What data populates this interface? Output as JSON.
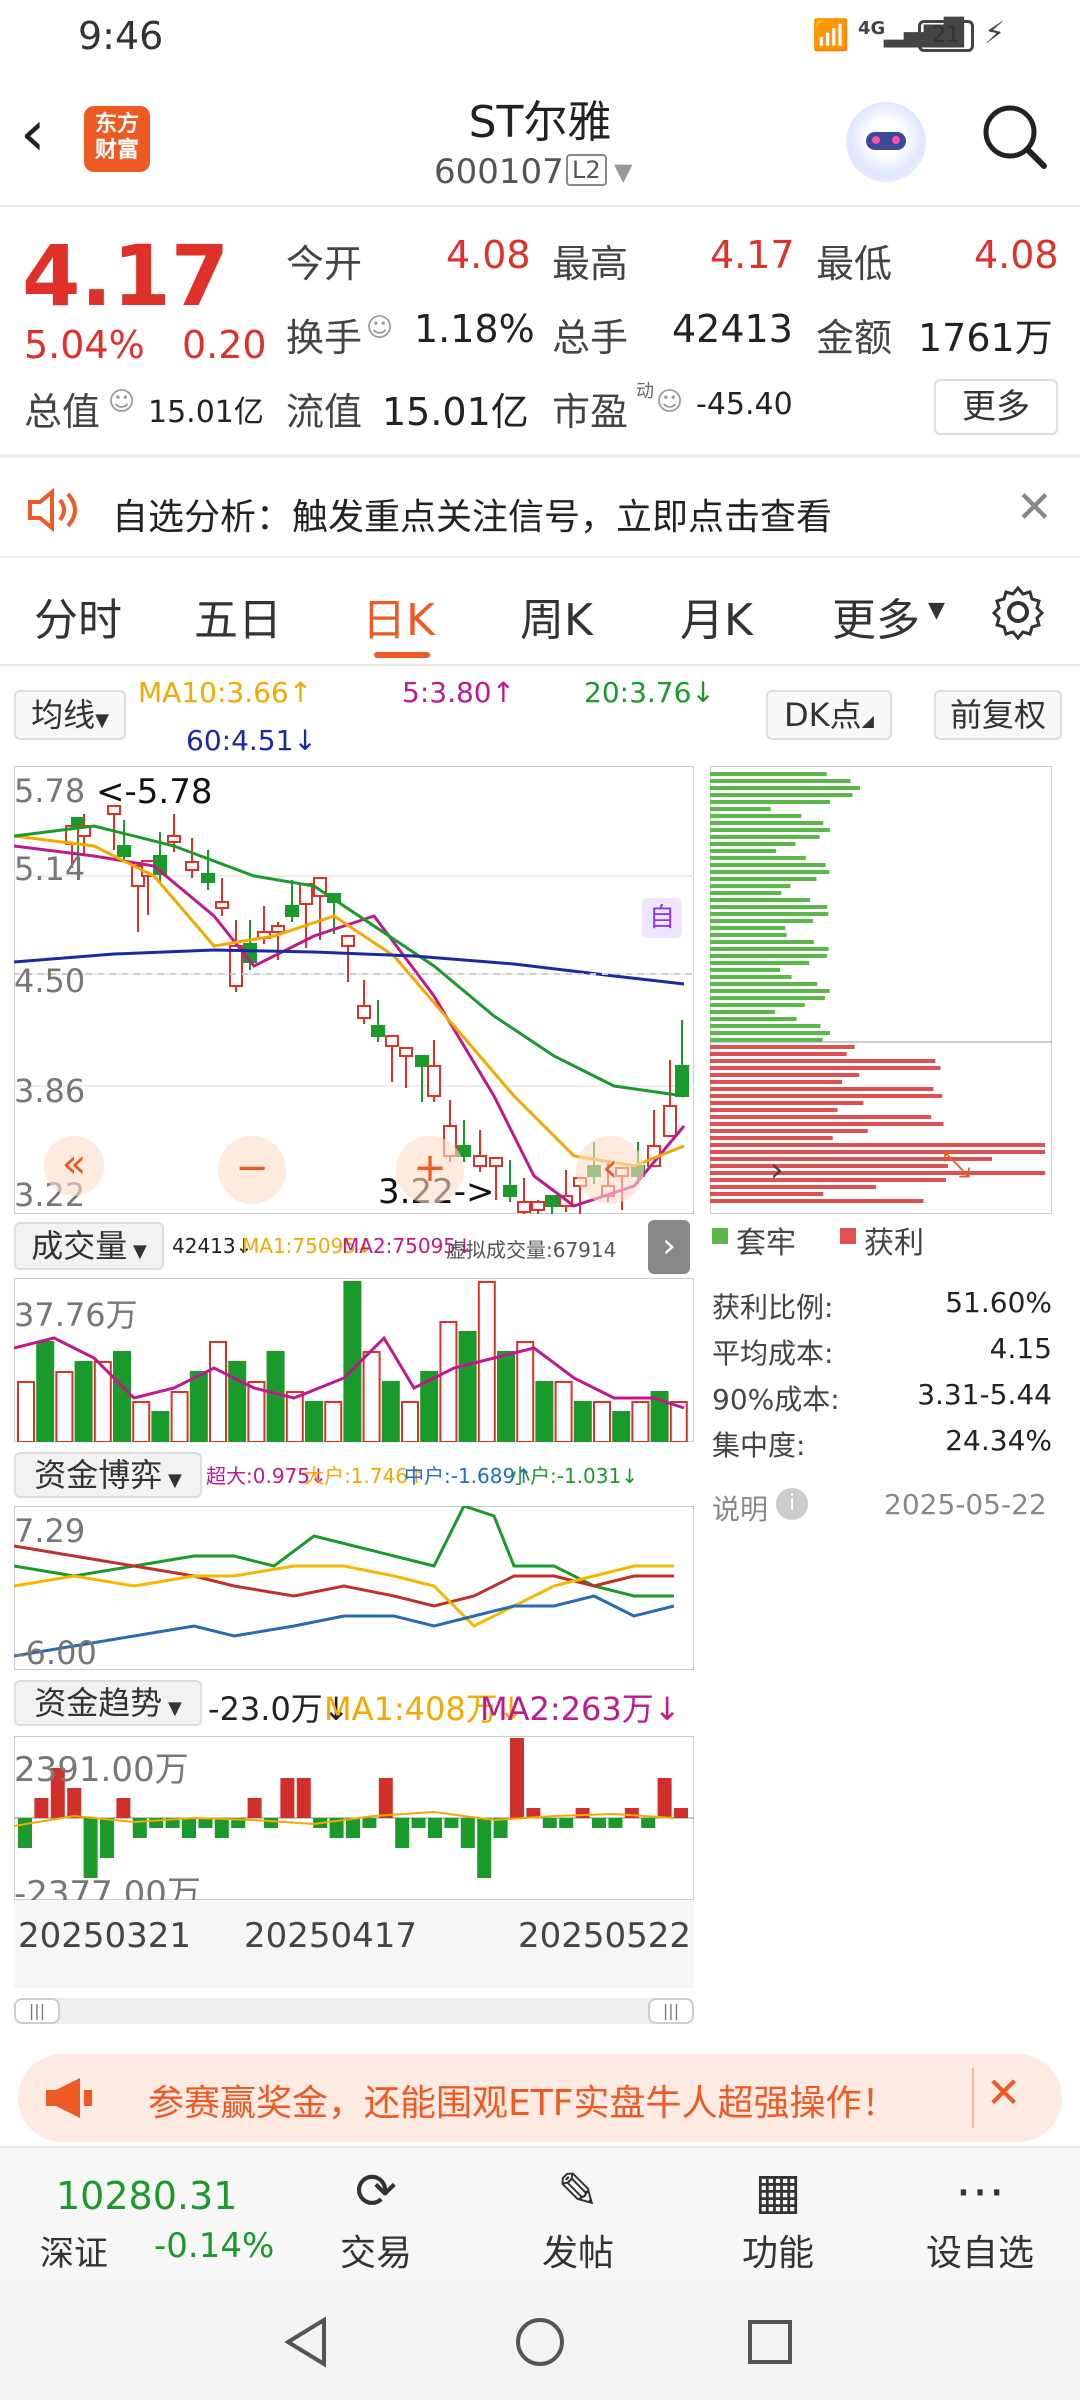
{
  "status": {
    "time": "9:46",
    "network": "4G",
    "battery": "21"
  },
  "header": {
    "logo_line1": "东方",
    "logo_line2": "财富",
    "title": "ST尔雅",
    "code": "600107",
    "level": "L2"
  },
  "quote": {
    "price": "4.17",
    "change_pct": "5.04%",
    "change": "0.20",
    "open_label": "今开",
    "open": "4.08",
    "high_label": "最高",
    "high": "4.17",
    "low_label": "最低",
    "low": "4.08",
    "turnover_label": "换手",
    "turnover": "1.18%",
    "volume_label": "总手",
    "volume": "42413",
    "amount_label": "金额",
    "amount": "1761万",
    "mcap_label": "总值",
    "mcap": "15.01亿",
    "float_label": "流值",
    "float": "15.01亿",
    "pe_label": "市盈",
    "pe_sup": "动",
    "pe": "-45.40",
    "more": "更多"
  },
  "banner": {
    "text": "自选分析：触发重点关注信号，立即点击查看"
  },
  "tabs": [
    "分时",
    "五日",
    "日K",
    "周K",
    "月K",
    "更多"
  ],
  "active_tab": 2,
  "kline": {
    "ma_btn": "均线",
    "ma10": "MA10:3.66↑",
    "ma5": "5:3.80↑",
    "ma20": "20:3.76↓",
    "ma60": "60:4.51↓",
    "dk_btn": "DK点",
    "fq_btn": "前复权",
    "y_labels": [
      "5.78",
      "5.14",
      "4.50",
      "3.86",
      "3.22"
    ],
    "max_note": "<-5.78",
    "min_note": "3.22->",
    "self_tag": "自"
  },
  "volume": {
    "btn": "成交量",
    "v": "42413↓",
    "ma1": "MA1:75095↓",
    "ma2": "MA2:75095↓",
    "virtual": "虚拟成交量:67914",
    "ymax": "37.76万"
  },
  "fund_game": {
    "btn": "资金博弈",
    "big": "超大:0.975↓",
    "large": "大户:1.746↑",
    "mid": "中户:-1.689↑",
    "small": "小户:-1.031↓",
    "ymax": "7.29",
    "ymin": "-6.00"
  },
  "fund_trend": {
    "btn": "资金趋势",
    "v": "-23.0万↓",
    "ma1": "MA1:408万↓",
    "ma2": "MA2:263万↓",
    "ymax": "2391.00万",
    "ymin": "-2377.00万"
  },
  "dates": [
    "20250321",
    "20250417",
    "20250522"
  ],
  "chip": {
    "legend_trap": "套牢",
    "legend_profit": "获利",
    "rows": [
      {
        "label": "获利比例:",
        "value": "51.60%"
      },
      {
        "label": "平均成本:",
        "value": "4.15"
      },
      {
        "label": "90%成本:",
        "value": "3.31-5.44"
      },
      {
        "label": "集中度:",
        "value": "24.34%"
      }
    ],
    "note": "说明",
    "date": "2025-05-22"
  },
  "ad": {
    "text": "参赛赢奖金，还能围观ETF实盘牛人超强操作！"
  },
  "bottom": {
    "index_value": "10280.31",
    "index_name": "深证",
    "index_change": "-0.14%",
    "items": [
      "交易",
      "发帖",
      "功能",
      "设自选"
    ]
  },
  "colors": {
    "red": "#e0302a",
    "green": "#1a9a2a",
    "ma5": "#c2188e",
    "ma10": "#f5a800",
    "ma20": "#1a9a2a",
    "ma60": "#1a2aa0"
  }
}
